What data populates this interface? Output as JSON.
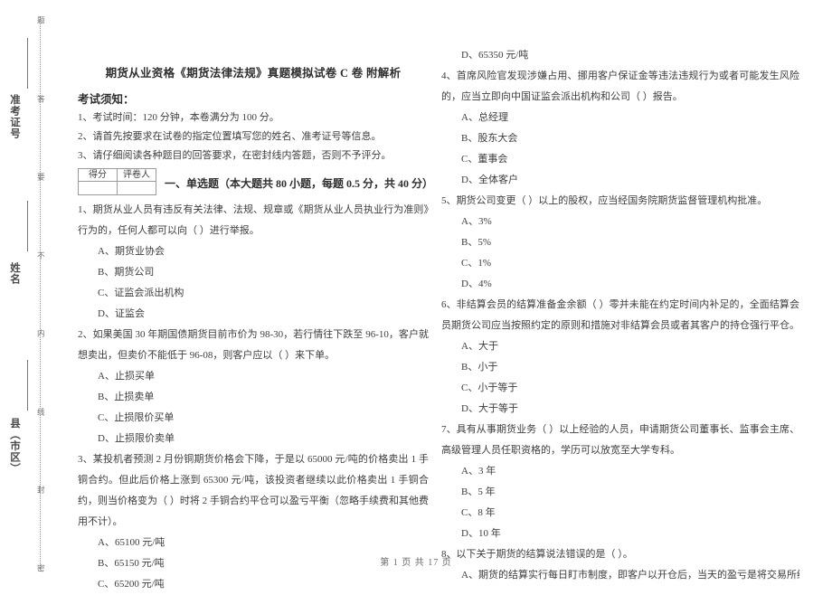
{
  "margin": {
    "seal_text_chars": [
      "题",
      "答",
      "要",
      "不",
      "内",
      "线",
      "封",
      "密"
    ],
    "fields": [
      {
        "label": "准考证号"
      },
      {
        "label": "姓名"
      },
      {
        "label": "县（市区）"
      }
    ]
  },
  "document": {
    "title": "期货从业资格《期货法律法规》真题模拟试卷 C 卷  附解析",
    "notice_heading": "考试须知：",
    "notices": [
      "1、考试时间：120 分钟，本卷满分为 100 分。",
      "2、请首先按要求在试卷的指定位置填写您的姓名、准考证号等信息。",
      "3、请仔细阅读各种题目的回答要求，在密封线内答题，否则不予评分。"
    ]
  },
  "score_box": {
    "header_score": "得分",
    "header_grader": "评卷人",
    "value_score": "",
    "value_grader": ""
  },
  "section": {
    "title": "一、单选题（本大题共 80 小题，每题 0.5 分，共 40 分）"
  },
  "questions_left": [
    {
      "stem": "1、期货从业人员有违反有关法律、法规、规章或《期货从业人员执业行为准则》行为的，任何人都可以向（    ）进行举报。",
      "options": [
        "A、期货业协会",
        "B、期货公司",
        "C、证监会派出机构",
        "D、证监会"
      ]
    },
    {
      "stem": "2、如果美国 30 年期国债期货目前市价为 98-30，若行情往下跌至 96-10，客户就想卖出，但卖价不能低于 96-08，则客户应以（    ）来下单。",
      "options": [
        "A、止损买单",
        "B、止损卖单",
        "C、止损限价买单",
        "D、止损限价卖单"
      ]
    },
    {
      "stem": "3、某投机者预测 2 月份铜期货价格会下降，于是以 65000 元/吨的价格卖出 1 手铜合约。但此后价格上涨到 65300 元/吨，该投资者继续以此价格卖出 1 手铜合约，则当价格变为（    ）时将 2 手铜合约平仓可以盈亏平衡（忽略手续费和其他费用不计）。",
      "options": [
        "A、65100 元/吨",
        "B、65150 元/吨",
        "C、65200 元/吨"
      ]
    }
  ],
  "questions_right": [
    {
      "stem": "",
      "options": [
        "D、65350 元/吨"
      ]
    },
    {
      "stem": "4、首席风险官发现涉嫌占用、挪用客户保证金等违法违规行为或者可能发生风险的，应当立即向中国证监会派出机构和公司（    ）报告。",
      "options": [
        "A、总经理",
        "B、股东大会",
        "C、董事会",
        "D、全体客户"
      ]
    },
    {
      "stem": "5、期货公司变更（    ）以上的股权，应当经国务院期货监督管理机构批准。",
      "options": [
        "A、3%",
        "B、5%",
        "C、1%",
        "D、4%"
      ]
    },
    {
      "stem": "6、非结算会员的结算准备金余额（    ）零并未能在约定时间内补足的，全面结算会员期货公司应当按照约定的原则和措施对非结算会员或者其客户的持仓强行平仓。",
      "options": [
        "A、大于",
        "B、小于",
        "C、小于等于",
        "D、大于等于"
      ]
    },
    {
      "stem": "7、具有从事期货业务（    ）以上经验的人员，申请期货公司董事长、监事会主席、高级管理人员任职资格的，学历可以放宽至大学专科。",
      "options": [
        "A、3 年",
        "B、5 年",
        "C、8 年",
        "D、10 年"
      ]
    },
    {
      "stem": "8、以下关于期货的结算说法错误的是（    ）。",
      "options": [
        "A、期货的结算实行每日盯市制度，即客户以开仓后，当天的盈亏是将交易所结算价与客户"
      ]
    }
  ],
  "footer": {
    "text": "第 1 页 共 17 页"
  }
}
